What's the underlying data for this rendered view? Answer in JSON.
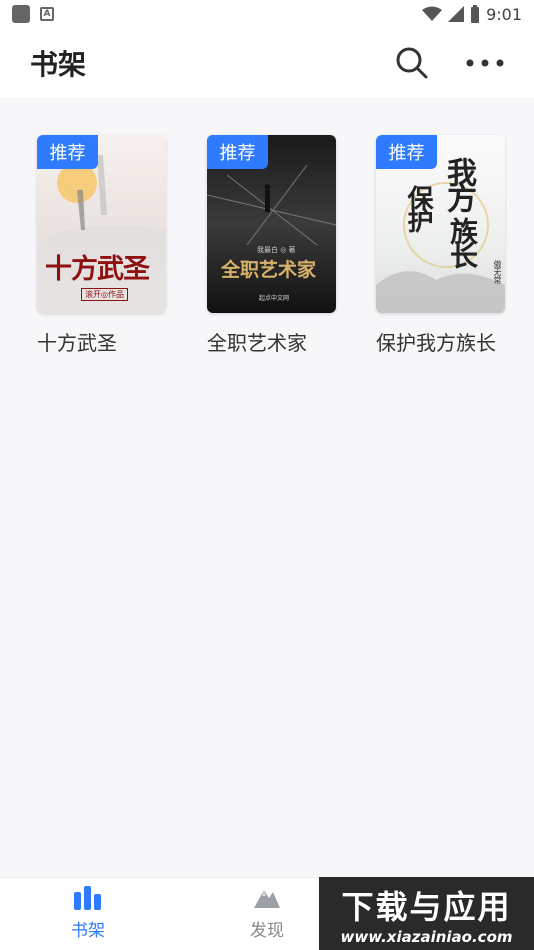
{
  "status": {
    "time": "9:01",
    "a_icon_letter": "A"
  },
  "header": {
    "title": "书架"
  },
  "books": [
    {
      "name": "十方武圣",
      "badge": "推荐",
      "cover_title": "十方武圣",
      "cover_author": "滚开◎作品"
    },
    {
      "name": "全职艺术家",
      "badge": "推荐",
      "cover_title": "全职艺术家",
      "cover_author": "我最白 ◎ 著",
      "cover_publisher": "起点中文网"
    },
    {
      "name": "保护我方族长",
      "badge": "推荐",
      "cover_title_a": "我方",
      "cover_title_b": "保护",
      "cover_title_c": "族长",
      "cover_author": "傲无常"
    }
  ],
  "nav": {
    "shelf": "书架",
    "discover": "发现"
  },
  "watermark": {
    "line1": "下载与应用",
    "line2": "www.xiazainiao.com"
  },
  "colors": {
    "accent": "#2f7bff"
  }
}
